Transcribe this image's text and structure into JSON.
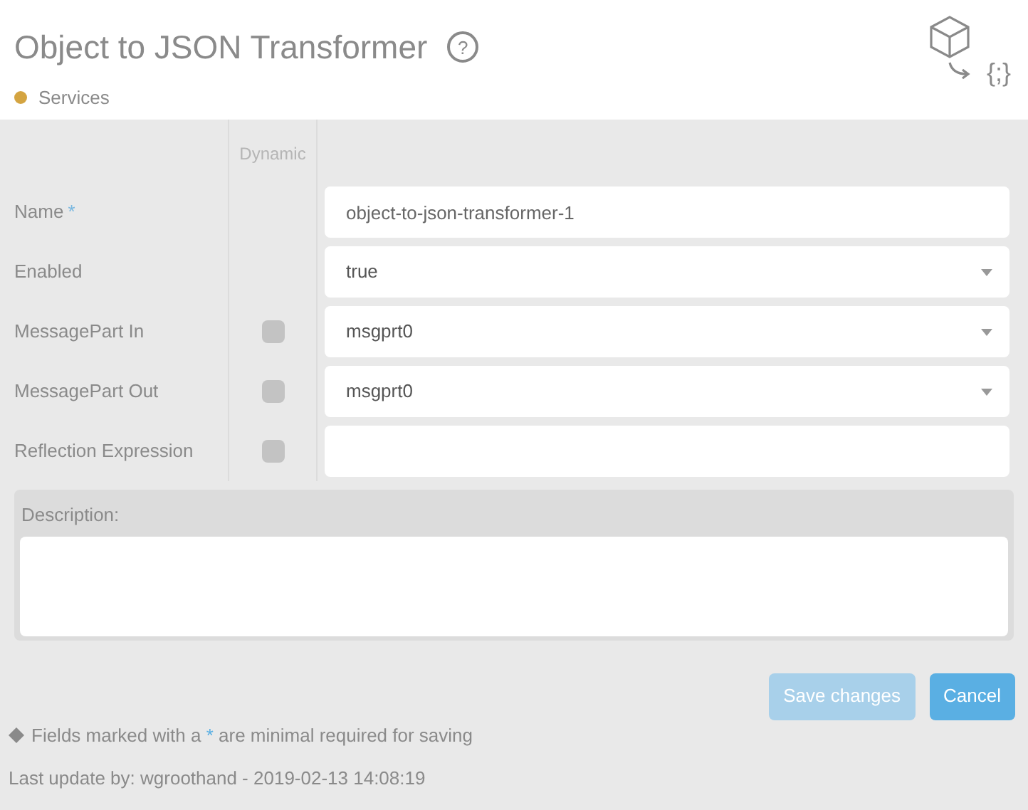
{
  "header": {
    "title": "Object to JSON Transformer",
    "help": "?",
    "category": {
      "label": "Services",
      "color": "#d4a441"
    },
    "logo_text": "{;}"
  },
  "form": {
    "dynamic_heading": "Dynamic",
    "fields": [
      {
        "label": "Name",
        "required": true,
        "kind": "text",
        "value": "object-to-json-transformer-1"
      },
      {
        "label": "Enabled",
        "required": false,
        "kind": "select",
        "value": "true"
      },
      {
        "label": "MessagePart In",
        "required": false,
        "kind": "select",
        "value": "msgprt0",
        "dynamic": false
      },
      {
        "label": "MessagePart Out",
        "required": false,
        "kind": "select",
        "value": "msgprt0",
        "dynamic": false
      },
      {
        "label": "Reflection Expression",
        "required": false,
        "kind": "text",
        "dynamic": false
      }
    ],
    "required_mark": "*",
    "description": {
      "label": "Description:"
    }
  },
  "buttons": [
    {
      "label": "Save changes",
      "disabled": true
    },
    {
      "label": "Cancel",
      "disabled": false
    }
  ],
  "note": {
    "before": "Fields marked with a",
    "marker": "*",
    "after": "are minimal required for saving"
  },
  "last_update": "Last update by: wgroothand - 2019-02-13 14:08:19"
}
